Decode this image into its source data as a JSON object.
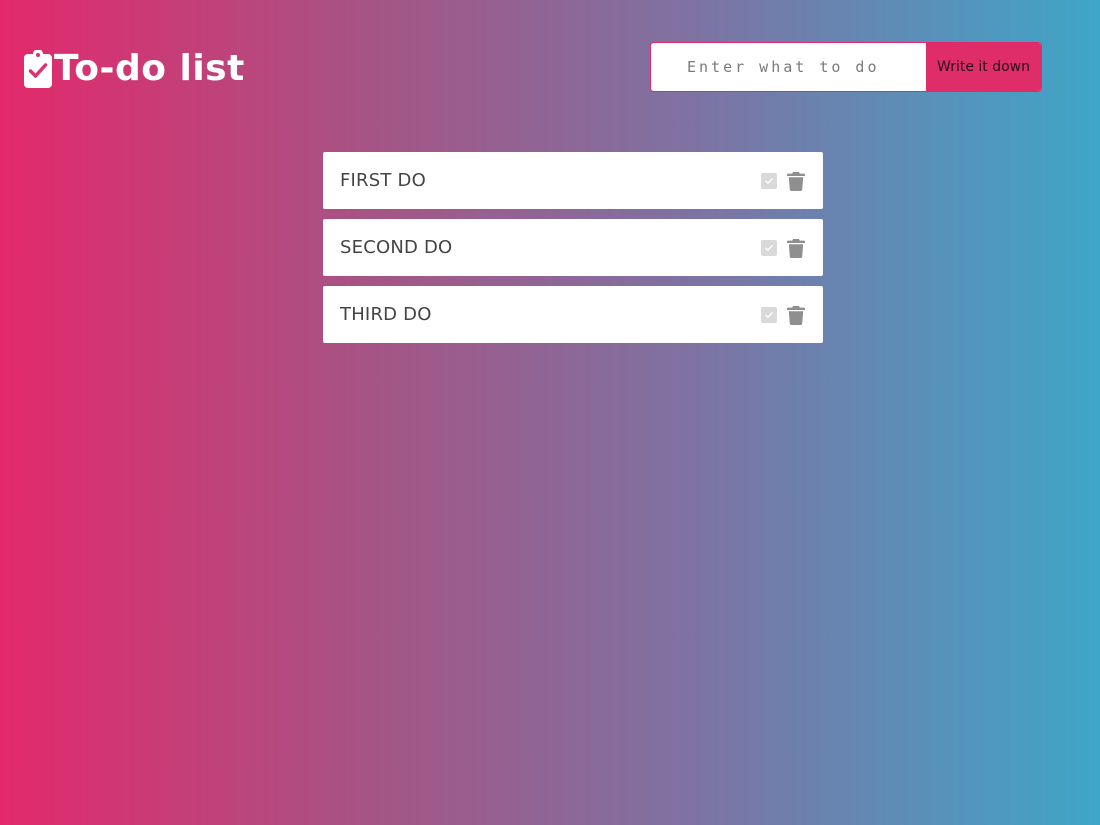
{
  "header": {
    "title": "To-do list",
    "icon": "clipboard-check-icon"
  },
  "composer": {
    "placeholder": "Enter what to do",
    "value": "",
    "button_label": "Write it down"
  },
  "todos": [
    {
      "text": "FIRST DO",
      "done": false
    },
    {
      "text": "SECOND DO",
      "done": false
    },
    {
      "text": "THIRD DO",
      "done": false
    }
  ],
  "icons": {
    "complete": "check-square-icon",
    "delete": "trash-icon"
  },
  "colors": {
    "gradient_start": "#e3296b",
    "gradient_end": "#3ea6c8",
    "accent": "#df2d6a",
    "item_background": "#ffffff"
  }
}
